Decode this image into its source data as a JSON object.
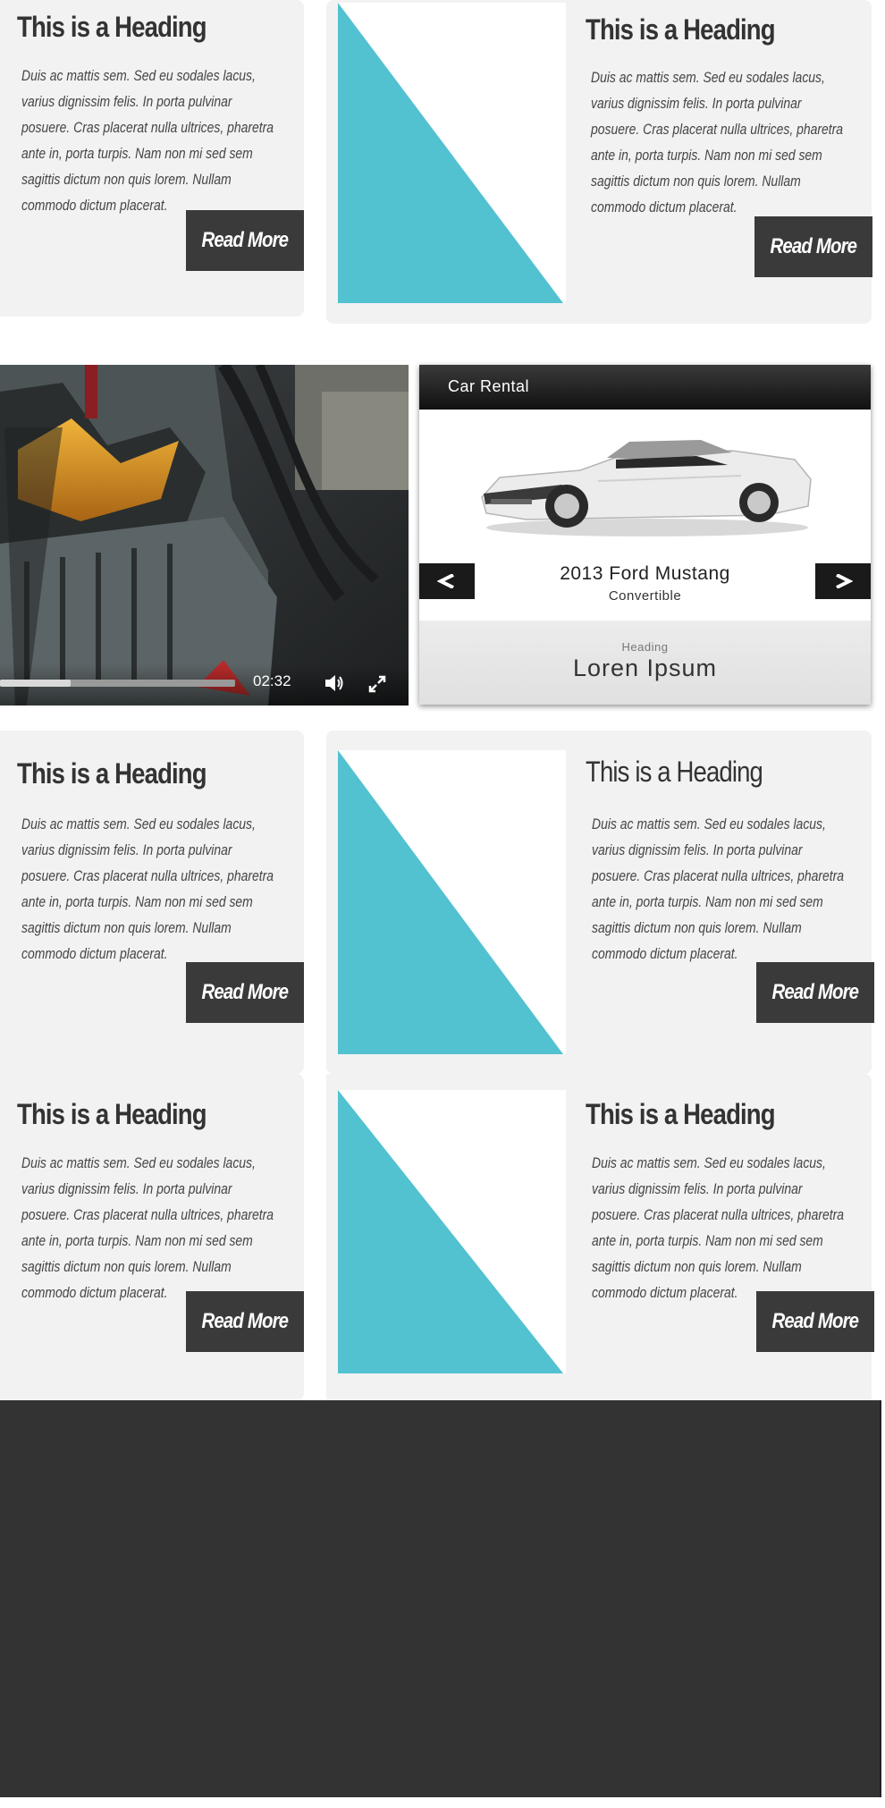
{
  "cards": [
    {
      "heading": "This is a Heading",
      "body": "Duis ac mattis sem. Sed eu sodales lacus, varius dignissim felis. In porta pulvinar posuere. Cras placerat nulla ultrices, pharetra ante in, porta turpis. Nam non mi sed sem sagittis dictum non quis lorem. Nullam commodo dictum placerat.",
      "button": "Read More"
    },
    {
      "heading": "This is a Heading",
      "body": "Duis ac mattis sem. Sed eu sodales lacus, varius dignissim felis. In porta pulvinar posuere. Cras placerat nulla ultrices, pharetra ante in, porta turpis. Nam non mi sed sem sagittis dictum non quis lorem. Nullam commodo dictum placerat.",
      "button": "Read More"
    },
    {
      "heading": "This is a Heading",
      "body": "Duis ac mattis sem. Sed eu sodales lacus, varius dignissim felis. In porta pulvinar posuere. Cras placerat nulla ultrices, pharetra ante in, porta turpis. Nam non mi sed sem sagittis dictum non quis lorem. Nullam commodo dictum placerat.",
      "button": "Read More"
    },
    {
      "heading": "This is a Heading",
      "body": "Duis ac mattis sem. Sed eu sodales lacus, varius dignissim felis. In porta pulvinar posuere. Cras placerat nulla ultrices, pharetra ante in, porta turpis. Nam non mi sed sem sagittis dictum non quis lorem. Nullam commodo dictum placerat.",
      "button": "Read More"
    },
    {
      "heading": "This is a Heading",
      "body": "Duis ac mattis sem. Sed eu sodales lacus, varius dignissim felis. In porta pulvinar posuere. Cras placerat nulla ultrices, pharetra ante in, porta turpis. Nam non mi sed sem sagittis dictum non quis lorem. Nullam commodo dictum placerat.",
      "button": "Read More"
    },
    {
      "heading": "This is a Heading",
      "body": "Duis ac mattis sem. Sed eu sodales lacus, varius dignissim felis. In porta pulvinar posuere. Cras placerat nulla ultrices, pharetra ante in, porta turpis. Nam non mi sed sem sagittis dictum non quis lorem. Nullam commodo dictum placerat.",
      "button": "Read More"
    }
  ],
  "video": {
    "time": "02:32",
    "progress": 0.3,
    "icons": [
      "volume-icon",
      "fullscreen-icon"
    ]
  },
  "car_rental": {
    "title": "Car Rental",
    "car_name": "2013 Ford Mustang",
    "car_type": "Convertible",
    "footer_label": "Heading",
    "footer_title": "Loren Ipsum",
    "icons": [
      "chevron-left-icon",
      "chevron-right-icon"
    ]
  },
  "colors": {
    "accent": "#52c1d0",
    "card_bg": "#f2f2f2",
    "button_bg": "#3a3a3a",
    "footer_bg": "#333333"
  }
}
